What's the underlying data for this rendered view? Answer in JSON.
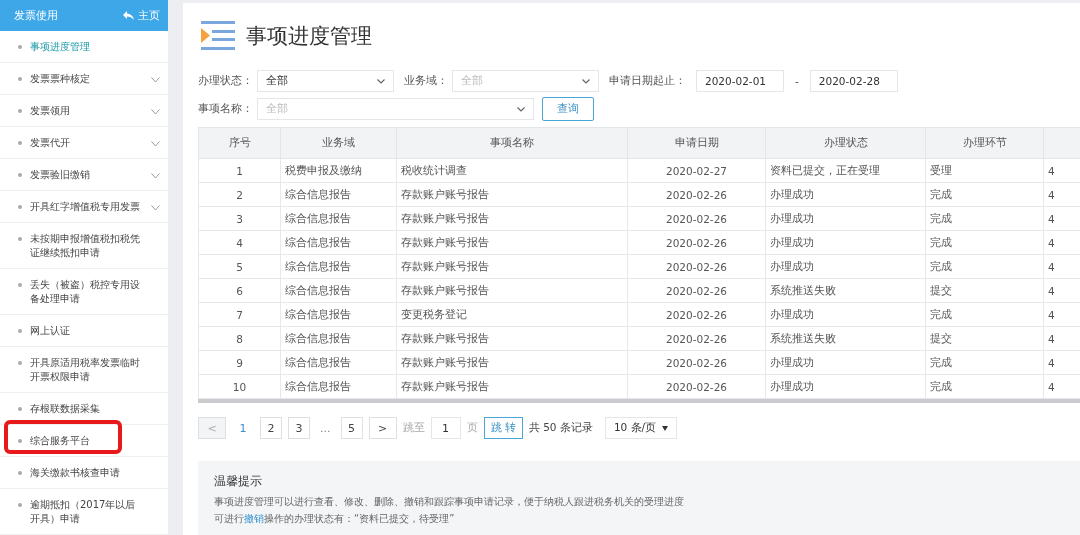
{
  "sidebar": {
    "title": "发票使用",
    "home_link": "主页",
    "items": [
      {
        "label": "事项进度管理",
        "selected": true,
        "expandable": false,
        "highlighted": false
      },
      {
        "label": "发票票种核定",
        "selected": false,
        "expandable": true,
        "highlighted": false
      },
      {
        "label": "发票领用",
        "selected": false,
        "expandable": true,
        "highlighted": false
      },
      {
        "label": "发票代开",
        "selected": false,
        "expandable": true,
        "highlighted": false
      },
      {
        "label": "发票验旧缴销",
        "selected": false,
        "expandable": true,
        "highlighted": false
      },
      {
        "label": "开具红字增值税专用发票",
        "selected": false,
        "expandable": true,
        "highlighted": false
      },
      {
        "label": "未按期申报增值税扣税凭证继续抵扣申请",
        "selected": false,
        "expandable": false,
        "highlighted": false
      },
      {
        "label": "丢失（被盗）税控专用设备处理申请",
        "selected": false,
        "expandable": false,
        "highlighted": false
      },
      {
        "label": "网上认证",
        "selected": false,
        "expandable": false,
        "highlighted": false
      },
      {
        "label": "开具原适用税率发票临时开票权限申请",
        "selected": false,
        "expandable": false,
        "highlighted": false
      },
      {
        "label": "存根联数据采集",
        "selected": false,
        "expandable": false,
        "highlighted": false
      },
      {
        "label": "综合服务平台",
        "selected": false,
        "expandable": false,
        "highlighted": true
      },
      {
        "label": "海关缴款书核查申请",
        "selected": false,
        "expandable": false,
        "highlighted": false
      },
      {
        "label": "逾期抵扣（2017年以后开具）申请",
        "selected": false,
        "expandable": false,
        "highlighted": false
      }
    ]
  },
  "page_title": "事项进度管理",
  "filters": {
    "status": {
      "label": "办理状态：",
      "value": "全部"
    },
    "domain": {
      "label": "业务域：",
      "placeholder": "全部"
    },
    "date_range": {
      "label": "申请日期起止：",
      "from": "2020-02-01",
      "separator": "-",
      "to": "2020-02-28"
    },
    "item_name": {
      "label": "事项名称：",
      "placeholder": "全部"
    },
    "query_button": "查询"
  },
  "table": {
    "columns": [
      "序号",
      "业务域",
      "事项名称",
      "申请日期",
      "办理状态",
      "办理环节",
      ""
    ],
    "rows": [
      [
        "1",
        "税费申报及缴纳",
        "税收统计调查",
        "2020-02-27",
        "资料已提交，正在受理",
        "受理",
        "4"
      ],
      [
        "2",
        "综合信息报告",
        "存款账户账号报告",
        "2020-02-26",
        "办理成功",
        "完成",
        "4"
      ],
      [
        "3",
        "综合信息报告",
        "存款账户账号报告",
        "2020-02-26",
        "办理成功",
        "完成",
        "4"
      ],
      [
        "4",
        "综合信息报告",
        "存款账户账号报告",
        "2020-02-26",
        "办理成功",
        "完成",
        "4"
      ],
      [
        "5",
        "综合信息报告",
        "存款账户账号报告",
        "2020-02-26",
        "办理成功",
        "完成",
        "4"
      ],
      [
        "6",
        "综合信息报告",
        "存款账户账号报告",
        "2020-02-26",
        "系统推送失败",
        "提交",
        "4"
      ],
      [
        "7",
        "综合信息报告",
        "变更税务登记",
        "2020-02-26",
        "办理成功",
        "完成",
        "4"
      ],
      [
        "8",
        "综合信息报告",
        "存款账户账号报告",
        "2020-02-26",
        "系统推送失败",
        "提交",
        "4"
      ],
      [
        "9",
        "综合信息报告",
        "存款账户账号报告",
        "2020-02-26",
        "办理成功",
        "完成",
        "4"
      ],
      [
        "10",
        "综合信息报告",
        "存款账户账号报告",
        "2020-02-26",
        "办理成功",
        "完成",
        "4"
      ]
    ]
  },
  "pagination": {
    "prev": "<",
    "pages": [
      {
        "label": "1",
        "selected": true
      },
      {
        "label": "2",
        "selected": false
      },
      {
        "label": "3",
        "selected": false
      },
      {
        "label": "...",
        "kind": "ellipsis",
        "selected": false
      },
      {
        "label": "5",
        "selected": false
      }
    ],
    "next": ">",
    "jump_label": "跳至",
    "jump_value": "1",
    "page_unit": "页",
    "jump_button": "跳 转",
    "total": "共 50 条记录",
    "page_size": "10 条/页"
  },
  "tips": {
    "title": "温馨提示",
    "text": "事项进度管理可以进行查看、修改、删除、撤销和跟踪事项申请记录，便于纳税人跟进税务机关的受理进度",
    "cancel_note": {
      "before": "可进行",
      "link": "撤销",
      "after": "操作的办理状态有：“资料已提交，待受理”"
    }
  }
}
